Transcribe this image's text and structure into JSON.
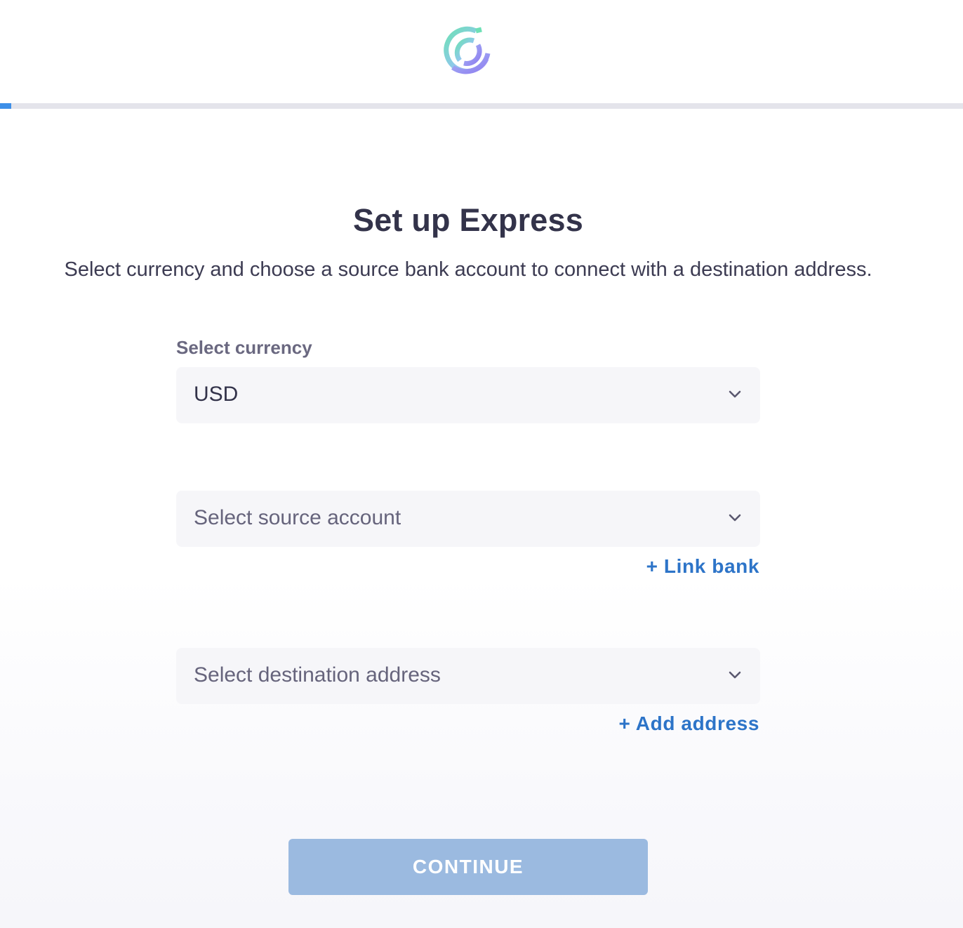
{
  "header": {
    "logo_icon": "circle-brand-logo-icon"
  },
  "progress": {
    "fraction": 0.012,
    "color": "#3d8fe8"
  },
  "main": {
    "title": "Set up Express",
    "subtitle": "Select currency and choose a source bank account to connect with a destination address."
  },
  "form": {
    "currency": {
      "label": "Select currency",
      "value": "USD",
      "icon": "chevron-down-icon"
    },
    "source_account": {
      "placeholder": "Select source account",
      "icon": "chevron-down-icon",
      "link_label": "+ Link bank"
    },
    "destination": {
      "placeholder": "Select destination address",
      "icon": "chevron-down-icon",
      "link_label": "+ Add address"
    }
  },
  "actions": {
    "continue_label": "CONTINUE"
  },
  "colors": {
    "accent": "#3d8fe8",
    "link": "#2d74c8",
    "button_disabled": "#9bbae0",
    "heading": "#33334a"
  }
}
